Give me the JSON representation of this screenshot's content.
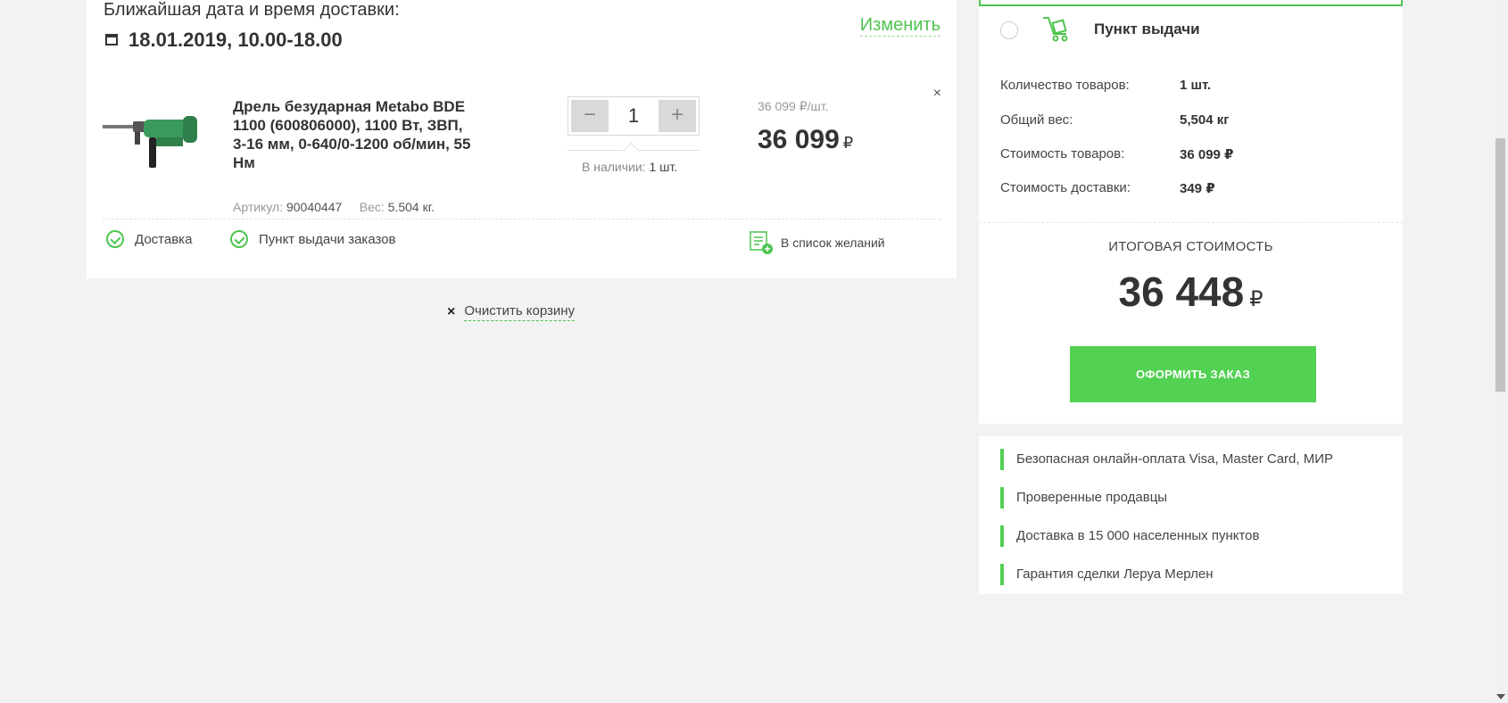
{
  "delivery": {
    "label": "Ближайшая дата и время доставки:",
    "date": "18.01.2019, 10.00-18.00",
    "change_link": "Изменить"
  },
  "item": {
    "title": "Дрель безударная Metabo BDE 1100 (600806000), 1100 Вт, ЗВП, 3-16 мм, 0-640/0-1200 об/мин, 55 Нм",
    "article_label": "Артикул:",
    "article_value": "90040447",
    "weight_label": "Вес:",
    "weight_value": "5.504 кг.",
    "quantity": "1",
    "qty_minus": "−",
    "qty_plus": "+",
    "stock_label": "В наличии:",
    "stock_value": "1 шт.",
    "unit_price": "36 099 ₽/шт.",
    "price": "36 099",
    "currency": "₽",
    "remove": "×",
    "options": [
      "Доставка",
      "Пункт выдачи заказов"
    ],
    "wishlist": "В список желаний"
  },
  "clear_cart": {
    "icon": "×",
    "label": "Очистить корзину"
  },
  "summary": {
    "pickup_label": "Пункт выдачи",
    "rows": [
      {
        "label": "Количество товаров:",
        "value": "1 шт."
      },
      {
        "label": "Общий вес:",
        "value": "5,504 кг"
      },
      {
        "label": "Стоимость товаров:",
        "value": "36 099 ₽"
      },
      {
        "label": "Стоимость доставки:",
        "value": "349 ₽"
      }
    ],
    "total_label": "ИТОГОВАЯ СТОИМОСТЬ",
    "total_value": "36 448",
    "total_currency": "₽",
    "checkout": "ОФОРМИТЬ ЗАКАЗ"
  },
  "benefits": [
    "Безопасная онлайн-оплата Visa, Master Card, МИР",
    "Проверенные продавцы",
    "Доставка в 15 000 населенных пунктов",
    "Гарантия сделки Леруа Мерлен"
  ],
  "colors": {
    "accent": "#53d153",
    "background": "#f2f2f2",
    "text": "#333333"
  },
  "icons": [
    "calendar-icon",
    "check-icon",
    "wishlist-icon",
    "close-icon",
    "cart-icon"
  ]
}
